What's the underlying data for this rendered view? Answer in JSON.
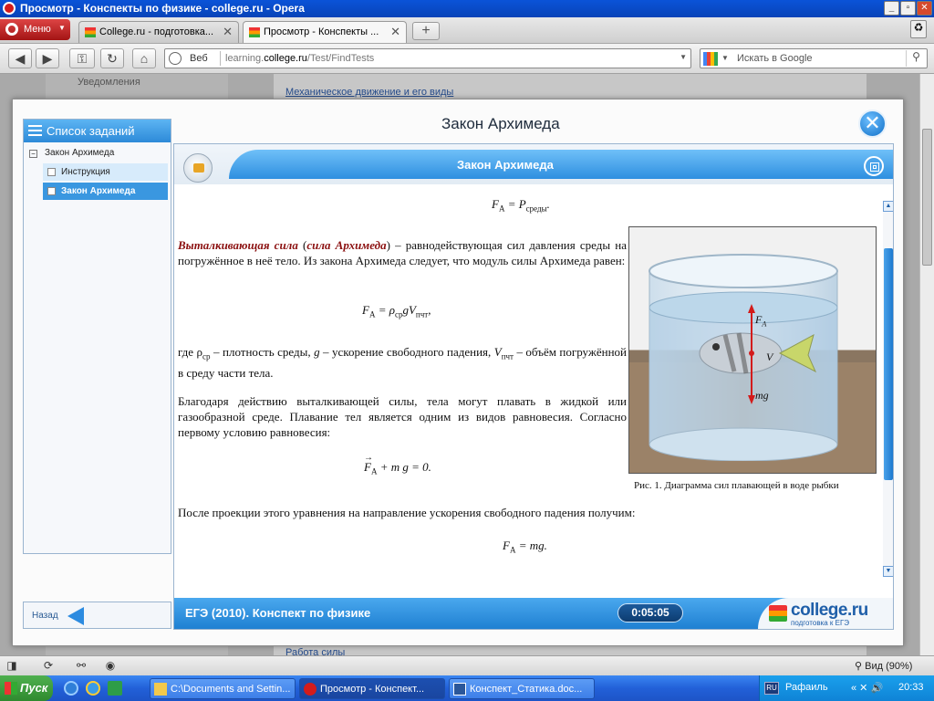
{
  "browser": {
    "window_title": "Просмотр - Конспекты по физике - college.ru - Opera",
    "menu_label": "Меню",
    "tabs": [
      {
        "label": "College.ru - подготовка..."
      },
      {
        "label": "Просмотр - Конспекты ..."
      }
    ],
    "address": {
      "scheme_label": "Веб",
      "domain_pre": "learning.",
      "domain": "college.ru",
      "path": "/Test/FindTests"
    },
    "search_placeholder": "Искать в Google",
    "zoom_label": "Вид (90%)"
  },
  "background_page": {
    "notifications": "Уведомления",
    "link_top": "Механическое движение и его виды",
    "link_bottom": "Работа силы"
  },
  "modal": {
    "title": "Закон Архимеда",
    "sidebar": {
      "header": "Список заданий",
      "tree_root": "Закон Архимеда",
      "items": [
        {
          "label": "Инструкция"
        },
        {
          "label": "Закон Архимеда"
        }
      ]
    },
    "back_label": "Назад",
    "panel_title": "Закон Архимеда",
    "content": {
      "formula1": {
        "lhs": "F",
        "lhs_sub": "А",
        "rhs": " = P",
        "rhs_sub": "среды",
        "tail": "."
      },
      "para1": {
        "term1": "Выталкивающая сила",
        "term2": "сила Архимеда",
        "text_a": " (",
        "text_b": ") – равнодействующая сил давления среды на погружённое в неё тело. Из закона Архимеда следует, что модуль силы Архимеда равен:"
      },
      "formula2": {
        "lhs": "F",
        "lhs_sub": "А",
        "mid": " = ρ",
        "mid_sub": "ср",
        "tail": "gV",
        "tail_sub": "пчт",
        "end": ","
      },
      "para2": {
        "a": "где ρ",
        "a_sub": "ср",
        "b": " – плотность среды, ",
        "g": "g",
        "c": " – ускорение свободного падения, ",
        "v": "V",
        "v_sub": "пчт",
        "d": " – объём погружённой в среду части тела."
      },
      "para3": "Благодаря действию выталкивающей силы, тела могут плавать в жидкой или газообразной среде. Плавание тел является одним из видов равновесия. Согласно первому условию равновесия:",
      "formula3": {
        "a": "F",
        "a_sub": "А",
        "b": " + m g = 0."
      },
      "para4": "После проекции этого уравнения на направление ускорения свободного падения получим:",
      "formula4": {
        "a": "F",
        "a_sub": "А",
        "b": " = mg."
      },
      "figure": {
        "caption": "Рис. 1. Диаграмма сил плавающей в воде рыбки",
        "label_fa": "F",
        "label_fa_sub": "A",
        "label_v": "V",
        "label_mg": "mg"
      }
    },
    "footer": {
      "title": "ЕГЭ (2010). Конспект по физике",
      "timer": "0:05:05",
      "brand_name": "college.ru",
      "brand_sub": "подготовка к ЕГЭ"
    }
  },
  "taskbar": {
    "start_label": "Пуск",
    "tasks": [
      {
        "label": "C:\\Documents and Settin..."
      },
      {
        "label": "Просмотр - Конспект..."
      },
      {
        "label": "Конспект_Статика.doc..."
      }
    ],
    "lang": "RU",
    "user": "Рафаиль",
    "clock": "20:33"
  },
  "colors": {
    "accent": "#2d8ad8",
    "term_red": "#8b1010",
    "title_bar": "#0a53d8"
  }
}
